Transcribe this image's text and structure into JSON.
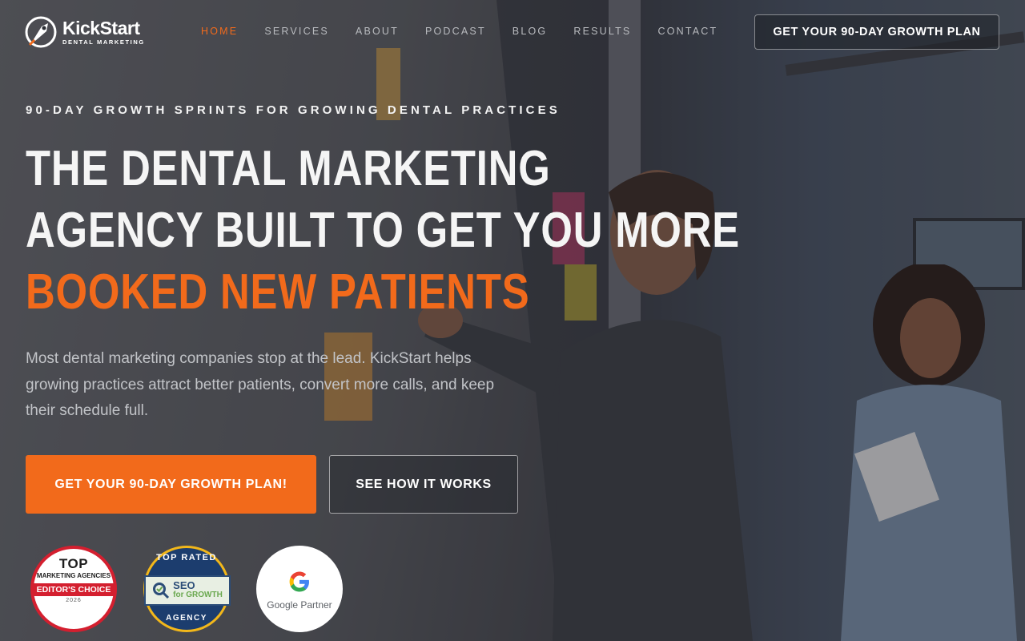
{
  "header": {
    "logo": {
      "name": "KickStart",
      "tagline": "DENTAL MARKETING"
    },
    "nav": [
      {
        "label": "HOME",
        "active": true
      },
      {
        "label": "SERVICES",
        "active": false
      },
      {
        "label": "ABOUT",
        "active": false
      },
      {
        "label": "PODCAST",
        "active": false
      },
      {
        "label": "BLOG",
        "active": false
      },
      {
        "label": "RESULTS",
        "active": false
      },
      {
        "label": "CONTACT",
        "active": false
      }
    ],
    "cta_label": "GET YOUR 90-DAY GROWTH PLAN"
  },
  "hero": {
    "eyebrow": "90-DAY GROWTH SPRINTS FOR GROWING DENTAL PRACTICES",
    "headline_line1": "THE DENTAL MARKETING",
    "headline_line2": "AGENCY BUILT TO GET YOU MORE",
    "headline_accent": "BOOKED NEW PATIENTS",
    "subcopy": "Most dental marketing companies stop at the lead. KickStart helps growing practices attract better patients, convert more calls, and keep their schedule full.",
    "primary_cta": "GET YOUR 90-DAY GROWTH PLAN!",
    "secondary_cta": "SEE HOW IT WORKS"
  },
  "badges": {
    "top_agencies": {
      "title": "TOP",
      "subtitle": "MARKETING AGENCIES",
      "ribbon": "EDITOR'S CHOICE",
      "year": "2026"
    },
    "seo_growth": {
      "top_text": "TOP RATED",
      "brand_line1": "SEO",
      "brand_line2": "for GROWTH",
      "bottom_text": "AGENCY"
    },
    "google": {
      "label": "Google Partner"
    }
  },
  "colors": {
    "accent": "#f26a1b",
    "text": "#f5f5f5",
    "muted": "#c2c4c8"
  }
}
